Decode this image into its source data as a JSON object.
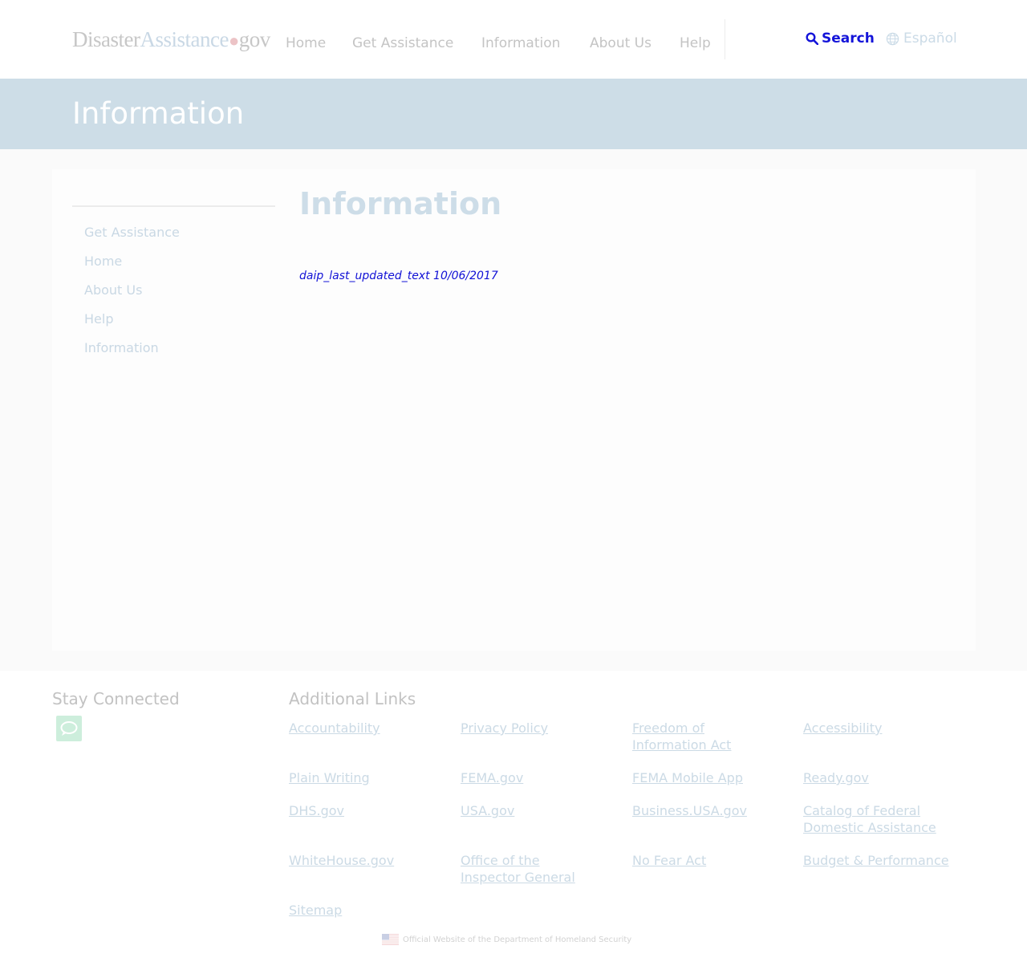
{
  "header": {
    "logo": {
      "part1": "Disaster",
      "part2": "Assistance",
      "dot": "●",
      "part3": "gov"
    },
    "nav": [
      "Home",
      "Get Assistance",
      "Information",
      "About Us",
      "Help"
    ],
    "search_label": "Search",
    "language_label": "Español"
  },
  "banner": {
    "title": "Information"
  },
  "sidebar": {
    "items": [
      "Get Assistance",
      "Home",
      "About Us",
      "Help",
      "Information"
    ]
  },
  "main": {
    "title": "Information",
    "last_updated": "daip_last_updated_text 10/06/2017"
  },
  "footer": {
    "stay_connected": "Stay Connected",
    "additional_links": "Additional Links",
    "links": [
      "Accountability",
      "Privacy Policy",
      "Freedom of Information Act",
      "Accessibility",
      "Plain Writing",
      "FEMA.gov",
      "FEMA Mobile App",
      "Ready.gov",
      "DHS.gov",
      "USA.gov",
      "Business.USA.gov",
      "Catalog of Federal Domestic Assistance",
      "WhiteHouse.gov",
      "Office of the Inspector General",
      "No Fear Act",
      "Budget & Performance",
      "Sitemap"
    ],
    "official_text": "Official Website of the Department of Homeland Security"
  },
  "colors": {
    "banner": "#cddde7",
    "search": "#1414d9",
    "link": "#cbdae5",
    "chat_icon_bg": "#cdeedc"
  },
  "icons": [
    "search-icon",
    "globe-icon",
    "chat-icon",
    "us-flag-icon"
  ]
}
